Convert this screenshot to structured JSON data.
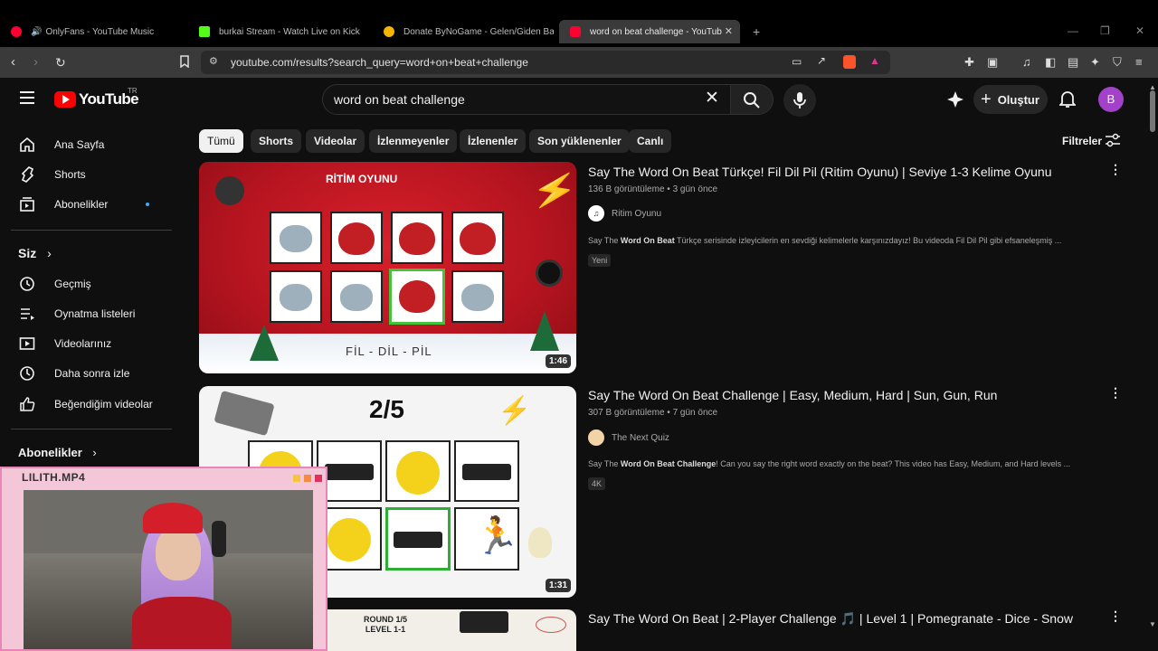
{
  "browser": {
    "tabs": [
      {
        "title": "OnlyFans - YouTube Music",
        "color": "#ff0033"
      },
      {
        "title": "burkai Stream - Watch Live on Kick",
        "color": "#53fc18"
      },
      {
        "title": "Donate ByNoGame - Gelen/Giden Ba",
        "color": "#f4b400"
      },
      {
        "title": "word on beat challenge - YouTub",
        "color": "#ff0033"
      }
    ],
    "url": "youtube.com/results?search_query=word+on+beat+challenge"
  },
  "header": {
    "logo": "YouTube",
    "country": "TR",
    "search_value": "word on beat challenge",
    "create_label": "Oluştur",
    "avatar_letter": "B"
  },
  "sidebar": {
    "items": [
      {
        "label": "Ana Sayfa",
        "icon": "home-icon"
      },
      {
        "label": "Shorts",
        "icon": "shorts-icon"
      },
      {
        "label": "Abonelikler",
        "icon": "subscriptions-icon"
      }
    ],
    "you_header": "Siz",
    "you_items": [
      {
        "label": "Geçmiş",
        "icon": "history-icon"
      },
      {
        "label": "Oynatma listeleri",
        "icon": "playlists-icon"
      },
      {
        "label": "Videolarınız",
        "icon": "your-videos-icon"
      },
      {
        "label": "Daha sonra izle",
        "icon": "watch-later-icon"
      },
      {
        "label": "Beğendiğim videolar",
        "icon": "liked-icon"
      }
    ],
    "subs_header": "Abonelikler"
  },
  "chips": [
    "Tümü",
    "Shorts",
    "Videolar",
    "İzlenmeyenler",
    "İzlenenler",
    "Son yüklenenler",
    "Canlı"
  ],
  "filters_label": "Filtreler",
  "results": [
    {
      "title": "Say The Word On Beat Türkçe! Fil Dil Pil (Ritim Oyunu) | Seviye 1-3 Kelime Oyunu",
      "views": "136 B görüntüleme",
      "age": "3 gün önce",
      "channel": "Ritim Oyunu",
      "desc_pre": "Say The ",
      "desc_bold": "Word On Beat",
      "desc_post": " Türkçe serisinde izleyicilerin en sevdiği kelimelerle karşınızdayız! Bu videoda Fil Dil Pil gibi efsaneleşmiş ...",
      "badge": "Yeni",
      "duration": "1:46",
      "thumb_banner": "RİTİM OYUNU",
      "thumb_caption": "FİL - DİL - PİL"
    },
    {
      "title": "Say The Word On Beat Challenge | Easy, Medium, Hard | Sun, Gun, Run",
      "views": "307 B görüntüleme",
      "age": "7 gün önce",
      "channel": "The Next Quiz",
      "desc_pre": "Say The ",
      "desc_bold": "Word On Beat Challenge",
      "desc_post": "! Can you say the right word exactly on the beat? This video has Easy, Medium, and Hard levels ...",
      "badge": "4K",
      "duration": "1:31",
      "thumb_counter": "2/5"
    },
    {
      "title": "Say The Word On Beat | 2-Player Challenge 🎵 | Level 1 | Pomegranate - Dice - Snow",
      "thumb_round": "ROUND 1/5",
      "thumb_level": "LEVEL 1-1"
    }
  ],
  "overlay": {
    "title": "LILITH.MP4"
  }
}
